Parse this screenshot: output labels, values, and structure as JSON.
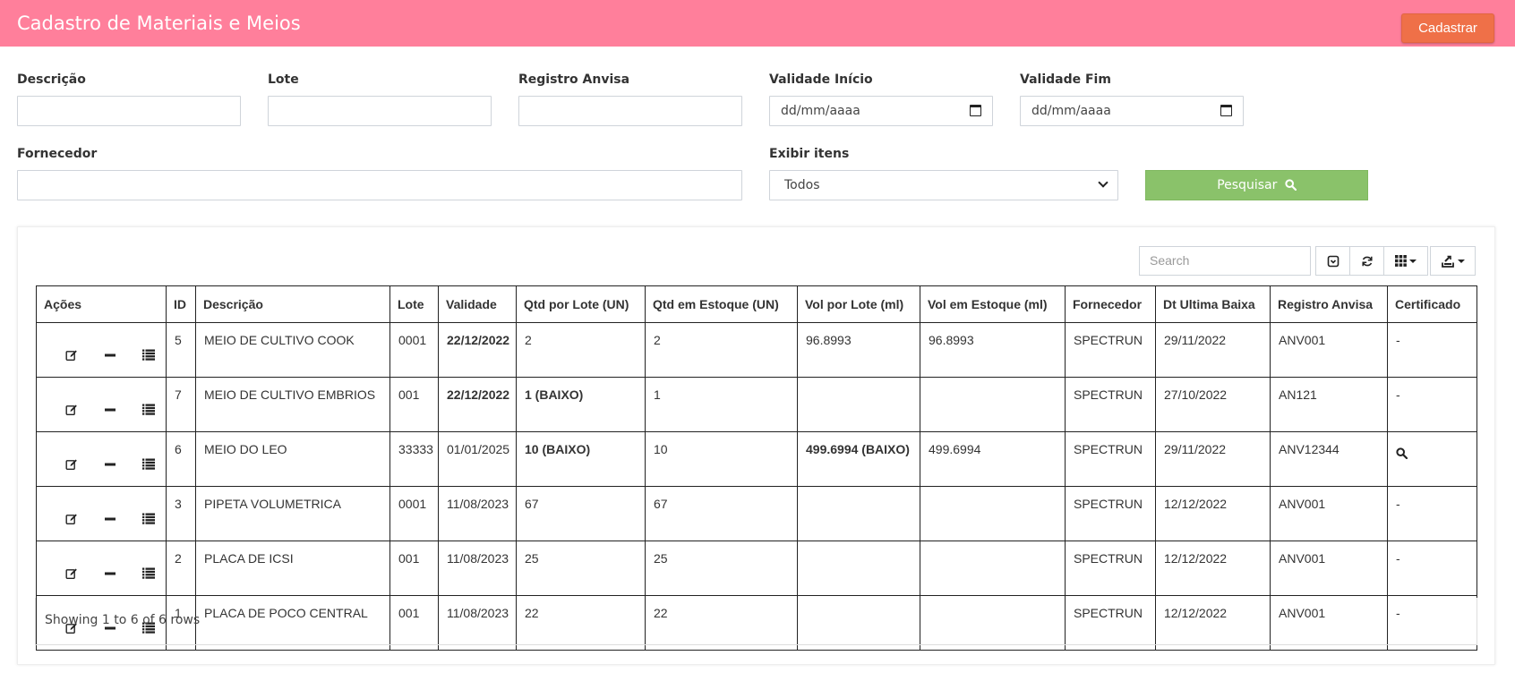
{
  "header": {
    "title": "Cadastro de Materiais e Meios",
    "cadastrar_label": "Cadastrar"
  },
  "filters": {
    "descricao_label": "Descrição",
    "lote_label": "Lote",
    "registro_label": "Registro Anvisa",
    "validade_inicio_label": "Validade Início",
    "validade_inicio_placeholder": "dd/mm/aaaa",
    "validade_fim_label": "Validade Fim",
    "validade_fim_placeholder": "dd/mm/aaaa",
    "fornecedor_label": "Fornecedor",
    "exibir_label": "Exibir itens",
    "exibir_value": "Todos",
    "pesquisar_label": "Pesquisar"
  },
  "toolbar": {
    "search_placeholder": "Search"
  },
  "table": {
    "columns": [
      "Ações",
      "ID",
      "Descrição",
      "Lote",
      "Validade",
      "Qtd por Lote (UN)",
      "Qtd em Estoque (UN)",
      "Vol por Lote (ml)",
      "Vol em Estoque (ml)",
      "Fornecedor",
      "Dt Ultima Baixa",
      "Registro Anvisa",
      "Certificado"
    ],
    "rows": [
      {
        "id": "5",
        "descricao": "MEIO DE CULTIVO COOK",
        "lote": "0001",
        "validade": "22/12/2022",
        "validade_alert": true,
        "qtd_lote": "2",
        "qtd_lote_alert": false,
        "qtd_estoque": "2",
        "vol_lote": "96.8993",
        "vol_lote_alert": false,
        "vol_estoque": "96.8993",
        "fornecedor": "SPECTRUN",
        "dt_baixa": "29/11/2022",
        "registro": "ANV001",
        "certificado": "-"
      },
      {
        "id": "7",
        "descricao": "MEIO DE CULTIVO EMBRIOS",
        "lote": "001",
        "validade": "22/12/2022",
        "validade_alert": true,
        "qtd_lote": "1 (BAIXO)",
        "qtd_lote_alert": true,
        "qtd_estoque": "1",
        "vol_lote": "",
        "vol_lote_alert": false,
        "vol_estoque": "",
        "fornecedor": "SPECTRUN",
        "dt_baixa": "27/10/2022",
        "registro": "AN121",
        "certificado": "-"
      },
      {
        "id": "6",
        "descricao": "MEIO DO LEO",
        "lote": "33333",
        "validade": "01/01/2025",
        "validade_alert": false,
        "qtd_lote": "10 (BAIXO)",
        "qtd_lote_alert": true,
        "qtd_estoque": "10",
        "vol_lote": "499.6994 (BAIXO)",
        "vol_lote_alert": true,
        "vol_estoque": "499.6994",
        "fornecedor": "SPECTRUN",
        "dt_baixa": "29/11/2022",
        "registro": "ANV12344",
        "certificado": "search-icon"
      },
      {
        "id": "3",
        "descricao": "PIPETA VOLUMETRICA",
        "lote": "0001",
        "validade": "11/08/2023",
        "validade_alert": false,
        "qtd_lote": "67",
        "qtd_lote_alert": false,
        "qtd_estoque": "67",
        "vol_lote": "",
        "vol_lote_alert": false,
        "vol_estoque": "",
        "fornecedor": "SPECTRUN",
        "dt_baixa": "12/12/2022",
        "registro": "ANV001",
        "certificado": "-"
      },
      {
        "id": "2",
        "descricao": "PLACA DE ICSI",
        "lote": "001",
        "validade": "11/08/2023",
        "validade_alert": false,
        "qtd_lote": "25",
        "qtd_lote_alert": false,
        "qtd_estoque": "25",
        "vol_lote": "",
        "vol_lote_alert": false,
        "vol_estoque": "",
        "fornecedor": "SPECTRUN",
        "dt_baixa": "12/12/2022",
        "registro": "ANV001",
        "certificado": "-"
      },
      {
        "id": "1",
        "descricao": "PLACA DE POCO CENTRAL",
        "lote": "001",
        "validade": "11/08/2023",
        "validade_alert": false,
        "qtd_lote": "22",
        "qtd_lote_alert": false,
        "qtd_estoque": "22",
        "vol_lote": "",
        "vol_lote_alert": false,
        "vol_estoque": "",
        "fornecedor": "SPECTRUN",
        "dt_baixa": "12/12/2022",
        "registro": "ANV001",
        "certificado": "-"
      }
    ]
  },
  "footer": {
    "showing": "Showing 1 to 6 of 6 rows"
  },
  "colors": {
    "header_bg": "#ff7f9b",
    "cadastrar_bg": "#ef7048",
    "pesquisar_bg": "#8ac26a",
    "alert_text": "#e8131f"
  }
}
